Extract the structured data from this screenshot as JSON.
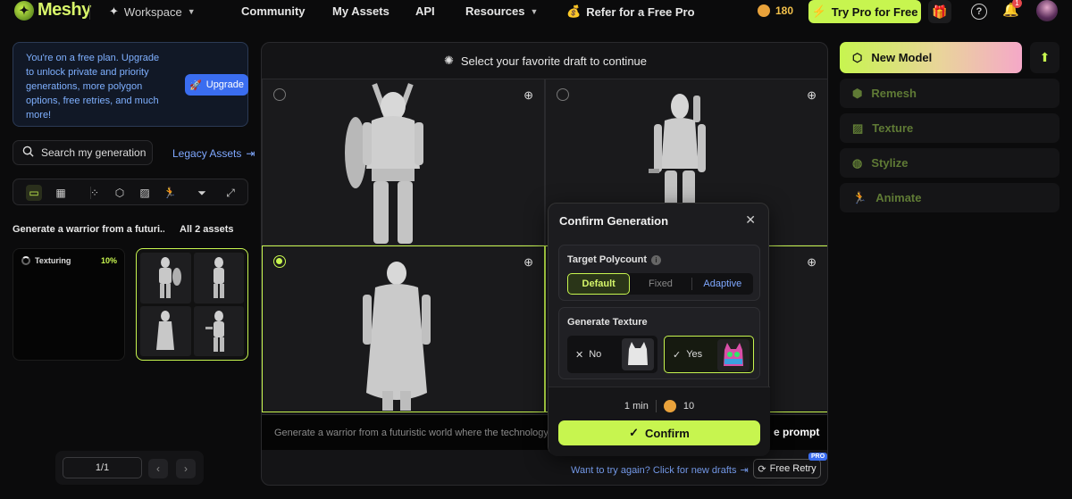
{
  "app": {
    "name": "Meshy"
  },
  "nav": {
    "workspace": "Workspace",
    "community": "Community",
    "my_assets": "My Assets",
    "api": "API",
    "resources": "Resources",
    "refer": "Refer for a Free Pro",
    "credits": "180",
    "try_pro": "Try Pro for Free",
    "notifications_count": "1"
  },
  "left": {
    "notice": "You're on a free plan. Upgrade to unlock private and priority generations, more polygon options, free retries, and much more!",
    "upgrade": "Upgrade",
    "search_placeholder": "Search my generation",
    "legacy": "Legacy Assets",
    "generation_title": "Generate a warrior from a futuri...",
    "all_assets": "All 2 assets",
    "asset_status": "Texturing",
    "asset_progress": "10%",
    "page": "1/1"
  },
  "center": {
    "instruction": "Select your favorite draft to continue",
    "prompt": "Generate a warrior from a futuristic world where the technology",
    "prompt_suffix": "e prompt",
    "retry_link": "Want to try again? Click for new drafts",
    "free_retry": "Free Retry",
    "pro_tag": "PRO",
    "selected_draft": 3
  },
  "modal": {
    "title": "Confirm Generation",
    "polycount_label": "Target Polycount",
    "polycount_options": [
      "Default",
      "Fixed",
      "Adaptive"
    ],
    "polycount_selected": "Default",
    "texture_label": "Generate Texture",
    "texture_no": "No",
    "texture_yes": "Yes",
    "texture_selected": "Yes",
    "time": "1 min",
    "cost": "10",
    "confirm": "Confirm"
  },
  "right": {
    "new_model": "New Model",
    "remesh": "Remesh",
    "texture": "Texture",
    "stylize": "Stylize",
    "animate": "Animate"
  },
  "colors": {
    "accent": "#c7f54f",
    "link": "#7fa8ff",
    "background": "#0b0b0c"
  }
}
